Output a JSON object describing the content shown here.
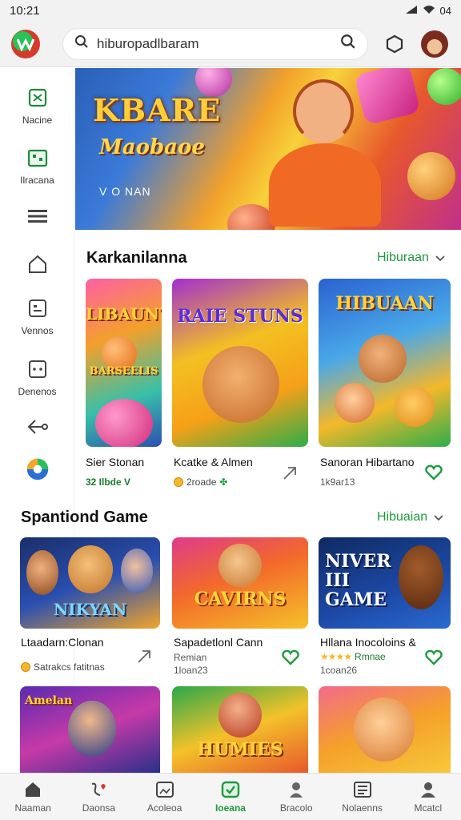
{
  "status": {
    "time": "10:21",
    "battery": "04"
  },
  "header": {
    "search_text": "hiburopadlbaram",
    "brand_colors": {
      "green": "#27c25a",
      "red": "#d63a2a"
    }
  },
  "sidebar": {
    "items": [
      {
        "icon": "gamepad-icon",
        "label": "Nacine"
      },
      {
        "icon": "grid-box-icon",
        "label": "Ilracana"
      },
      {
        "icon": "list-icon",
        "label": ""
      },
      {
        "icon": "home-icon",
        "label": ""
      },
      {
        "icon": "calendar-icon",
        "label": "Vennos"
      },
      {
        "icon": "dice-icon",
        "label": "Denenos"
      },
      {
        "icon": "back-arrow-icon",
        "label": ""
      },
      {
        "icon": "app-logo-icon",
        "label": ""
      }
    ]
  },
  "banner": {
    "title": "KBARE",
    "subtitle": "Maobaoe",
    "tagline": "V O NAN"
  },
  "section1": {
    "title": "Karkanilanna",
    "link": "Hiburaan",
    "cards": [
      {
        "art": "LIBAUNT",
        "art2": "BARSEELIS",
        "title": "Sier Stonan",
        "meta": "32 Ilbde V",
        "accent": "#1e9a3e"
      },
      {
        "art": "RAIE STUNS",
        "title": "Kcatke & Almen",
        "meta": "2roade",
        "accent": "#1e9a3e"
      },
      {
        "art": "HIBUAAN",
        "title": "Sanoran Hibartano",
        "meta": "1k9ar13",
        "accent": "#1e9a3e"
      }
    ]
  },
  "section2": {
    "title": "Spantiond Game",
    "link": "Hibuaian",
    "cards": [
      {
        "art": "NIKYAN",
        "title": "Ltaadarn:Clonan",
        "meta": "Satrakcs fatitnas"
      },
      {
        "art": "CAVIRNS",
        "title": "Sapadetlonl Cann",
        "meta": "Remian",
        "meta2": "1loan23"
      },
      {
        "art": "NIVER III GAME",
        "title": "Hllana Inocoloins &",
        "meta": "Rmnae",
        "meta2": "1coan26"
      }
    ]
  },
  "section3": {
    "cards": [
      {
        "art": "Amelan"
      },
      {
        "art": "HUMIES"
      },
      {
        "art": ""
      }
    ]
  },
  "bottom_nav": [
    {
      "icon": "home-icon",
      "label": "Naaman",
      "active": false
    },
    {
      "icon": "heart-curve-icon",
      "label": "Daonsa",
      "active": false
    },
    {
      "icon": "image-icon",
      "label": "Acoleoa",
      "active": false
    },
    {
      "icon": "gamepad-icon",
      "label": "Ioeana",
      "active": true
    },
    {
      "icon": "person-icon",
      "label": "Bracolo",
      "active": false
    },
    {
      "icon": "news-icon",
      "label": "Nolaenns",
      "active": false
    },
    {
      "icon": "profile-icon",
      "label": "Mcatcl",
      "active": false
    }
  ]
}
